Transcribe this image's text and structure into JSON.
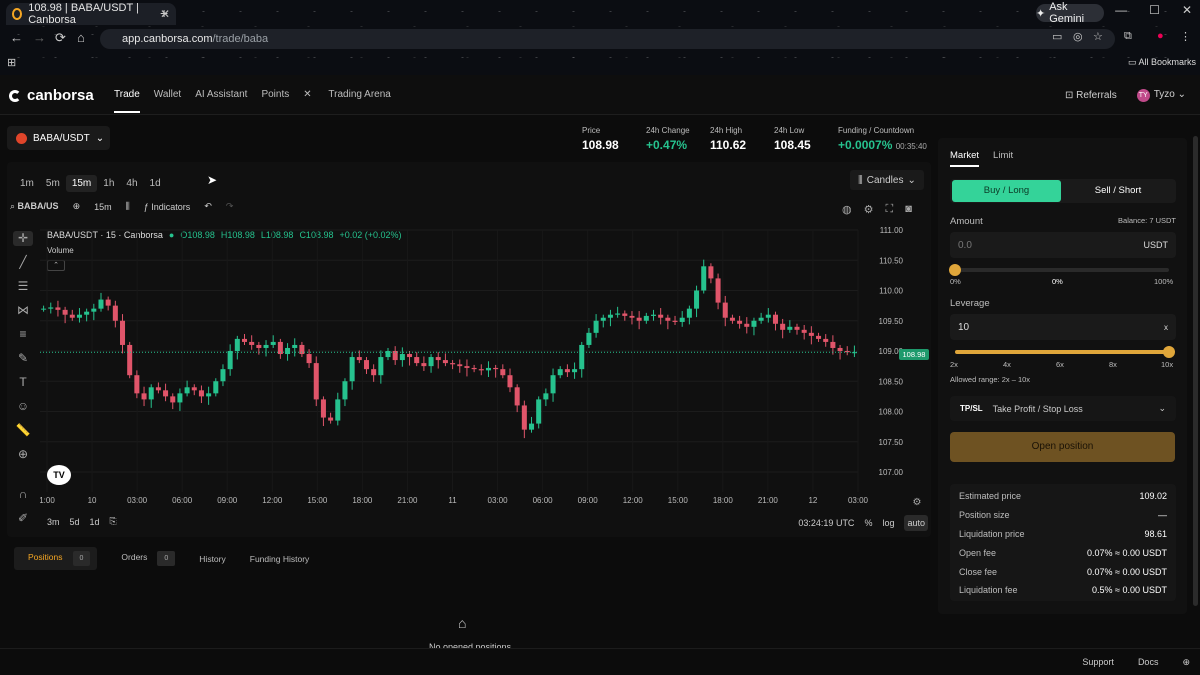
{
  "browser": {
    "tab_title": "108.98 | BABA/USDT | Canborsa",
    "new_tab": "+",
    "gemini": "Ask Gemini",
    "url_host": "app.canborsa.com",
    "url_path": "/trade/baba",
    "bookmarks": "All Bookmarks"
  },
  "header": {
    "logo": "canborsa",
    "nav": [
      "Trade",
      "Wallet",
      "AI Assistant",
      "Points",
      "Trading Arena"
    ],
    "referrals": "Referrals",
    "user": "Tyzo",
    "user_initials": "TY"
  },
  "symbol": "BABA/USDT",
  "stats": {
    "price_label": "Price",
    "price": "108.98",
    "change_label": "24h Change",
    "change": "+0.47%",
    "high_label": "24h High",
    "high": "110.62",
    "low_label": "24h Low",
    "low": "108.45",
    "funding_label": "Funding / Countdown",
    "funding": "+0.0007%",
    "countdown": "00:35:40"
  },
  "timeframes": [
    "1m",
    "5m",
    "15m",
    "1h",
    "4h",
    "1d"
  ],
  "active_timeframe": "15m",
  "chart_type": "Candles",
  "toolbar": {
    "symbol": "BABA/US",
    "interval": "15m",
    "indicators": "Indicators"
  },
  "legend": {
    "title": "BABA/USDT · 15 · Canborsa",
    "o": "O108.98",
    "h": "H108.98",
    "l": "L108.98",
    "c": "C108.98",
    "chg": "+0.02 (+0.02%)",
    "volume": "Volume"
  },
  "chart_data": {
    "type": "candlestick",
    "title": "BABA/USDT · 15 · Canborsa",
    "y_ticks": [
      "111.00",
      "110.50",
      "110.00",
      "109.50",
      "109.00",
      "108.50",
      "108.00",
      "107.50",
      "107.00"
    ],
    "ylim": [
      107.0,
      111.0
    ],
    "x_ticks": [
      "1:00",
      "10",
      "03:00",
      "06:00",
      "09:00",
      "12:00",
      "15:00",
      "18:00",
      "21:00",
      "11",
      "03:00",
      "06:00",
      "09:00",
      "12:00",
      "15:00",
      "18:00",
      "21:00",
      "12",
      "03:00"
    ],
    "last_price": 108.98,
    "close_series": [
      109.7,
      109.72,
      109.68,
      109.6,
      109.55,
      109.6,
      109.65,
      109.7,
      109.85,
      109.75,
      109.5,
      109.1,
      108.6,
      108.3,
      108.2,
      108.4,
      108.35,
      108.25,
      108.15,
      108.3,
      108.4,
      108.35,
      108.25,
      108.3,
      108.5,
      108.7,
      109.0,
      109.2,
      109.15,
      109.1,
      109.05,
      109.1,
      109.15,
      108.95,
      109.05,
      109.1,
      108.95,
      108.8,
      108.2,
      107.9,
      107.85,
      108.2,
      108.5,
      108.9,
      108.85,
      108.7,
      108.6,
      108.9,
      109.0,
      108.85,
      108.95,
      108.9,
      108.8,
      108.75,
      108.9,
      108.85,
      108.8,
      108.78,
      108.75,
      108.72,
      108.7,
      108.68,
      108.72,
      108.7,
      108.6,
      108.4,
      108.1,
      107.7,
      107.8,
      108.2,
      108.3,
      108.6,
      108.7,
      108.65,
      108.7,
      109.1,
      109.3,
      109.5,
      109.55,
      109.6,
      109.62,
      109.58,
      109.55,
      109.5,
      109.58,
      109.6,
      109.55,
      109.5,
      109.48,
      109.55,
      109.7,
      110.0,
      110.4,
      110.2,
      109.8,
      109.55,
      109.5,
      109.45,
      109.4,
      109.5,
      109.55,
      109.6,
      109.45,
      109.35,
      109.4,
      109.35,
      109.3,
      109.25,
      109.2,
      109.15,
      109.05,
      109.0,
      108.98,
      108.98
    ]
  },
  "bottom": {
    "ranges": [
      "3m",
      "5d",
      "1d"
    ],
    "time": "03:24:19 UTC",
    "pct": "%",
    "log": "log",
    "auto": "auto"
  },
  "positions": {
    "tabs": [
      {
        "label": "Positions",
        "count": "0"
      },
      {
        "label": "Orders",
        "count": "0"
      },
      {
        "label": "History"
      },
      {
        "label": "Funding History"
      }
    ],
    "empty": "No opened positions"
  },
  "order": {
    "tabs": [
      "Market",
      "Limit"
    ],
    "buy": "Buy / Long",
    "sell": "Sell / Short",
    "amount_label": "Amount",
    "balance": "Balance: 7 USDT",
    "amount_placeholder": "0.0",
    "amount_unit": "USDT",
    "pct_left": "0%",
    "pct_mid": "0%",
    "pct_right": "100%",
    "amount_fraction": 0,
    "leverage_label": "Leverage",
    "leverage_value": "10",
    "leverage_unit": "x",
    "lev_ticks": [
      "2x",
      "4x",
      "6x",
      "8x",
      "10x"
    ],
    "leverage_fraction": 1,
    "allowed": "Allowed range: 2x – 10x",
    "tpsl_tag": "TP/SL",
    "tpsl_label": "Take Profit / Stop Loss",
    "open": "Open position",
    "rows": [
      {
        "label": "Estimated price",
        "value": "109.02"
      },
      {
        "label": "Position size",
        "value": "—"
      },
      {
        "label": "Liquidation price",
        "value": "98.61"
      },
      {
        "label": "Open fee",
        "value": "0.07% ≈ 0.00 USDT"
      },
      {
        "label": "Close fee",
        "value": "0.07% ≈ 0.00 USDT"
      },
      {
        "label": "Liquidation fee",
        "value": "0.5% ≈ 0.00 USDT"
      }
    ]
  },
  "footer": {
    "support": "Support",
    "docs": "Docs"
  },
  "colors": {
    "up": "#26c28e",
    "down": "#e0556a",
    "accent": "#f5a623"
  }
}
